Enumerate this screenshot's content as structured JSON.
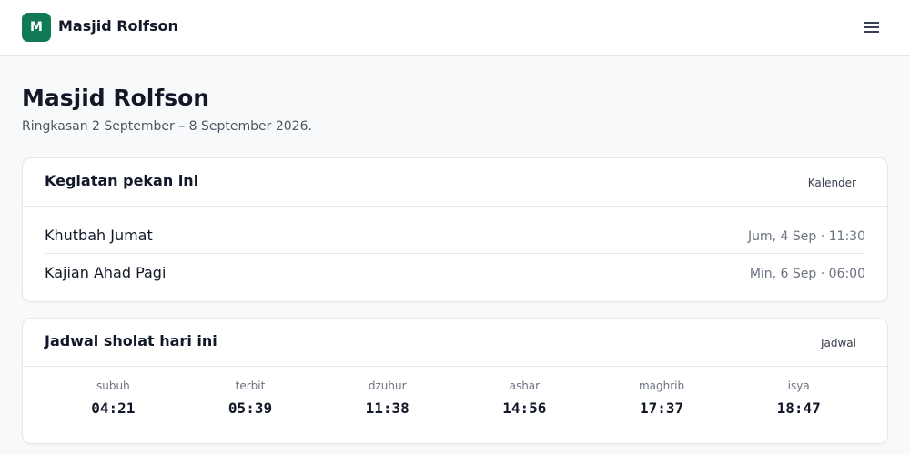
{
  "header": {
    "logo_letter": "M",
    "brand": "Masjid Rolfson",
    "menu_icon": "hamburger-menu-icon",
    "accent_color": "#0f7a55"
  },
  "page": {
    "title": "Masjid Rolfson",
    "subtitle": "Ringkasan 2 September – 8 September 2026."
  },
  "events_card": {
    "title": "Kegiatan pekan ini",
    "link_label": "Kalender",
    "events": [
      {
        "name": "Khutbah Jumat",
        "time": "Jum, 4 Sep · 11:30"
      },
      {
        "name": "Kajian Ahad Pagi",
        "time": "Min, 6 Sep · 06:00"
      }
    ]
  },
  "prayer_card": {
    "title": "Jadwal sholat hari ini",
    "link_label": "Jadwal",
    "prayers": [
      {
        "name": "subuh",
        "time": "04:21"
      },
      {
        "name": "terbit",
        "time": "05:39"
      },
      {
        "name": "dzuhur",
        "time": "11:38"
      },
      {
        "name": "ashar",
        "time": "14:56"
      },
      {
        "name": "maghrib",
        "time": "17:37"
      },
      {
        "name": "isya",
        "time": "18:47"
      }
    ]
  }
}
